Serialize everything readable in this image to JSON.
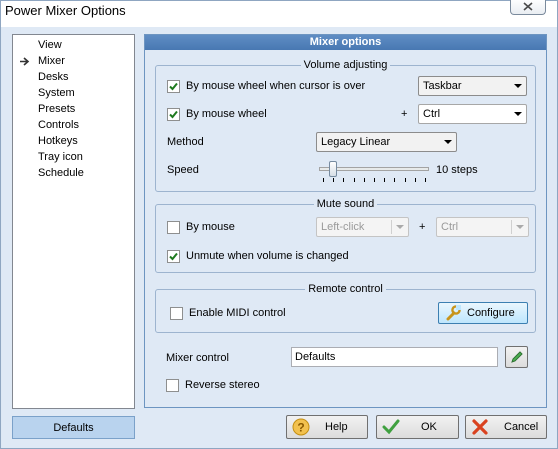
{
  "window": {
    "title": "Power Mixer Options"
  },
  "nav": {
    "items": [
      {
        "label": "View"
      },
      {
        "label": "Mixer",
        "selected": true
      },
      {
        "label": "Desks"
      },
      {
        "label": "System"
      },
      {
        "label": "Presets"
      },
      {
        "label": "Controls"
      },
      {
        "label": "Hotkeys"
      },
      {
        "label": "Tray icon"
      },
      {
        "label": "Schedule"
      }
    ]
  },
  "panel": {
    "header": "Mixer options",
    "volume": {
      "title": "Volume adjusting",
      "wheel_over": {
        "label": "By mouse wheel when cursor is over",
        "checked": true,
        "target": "Taskbar"
      },
      "wheel": {
        "label": "By mouse wheel",
        "checked": true,
        "plus": "+",
        "modifier": "Ctrl"
      },
      "method": {
        "label": "Method",
        "value": "Legacy Linear"
      },
      "speed": {
        "label": "Speed",
        "value_text": "10 steps",
        "steps": 10,
        "ticks": 11,
        "position": 1
      }
    },
    "mute": {
      "title": "Mute sound",
      "by_mouse": {
        "label": "By mouse",
        "checked": false,
        "button": "Left-click",
        "plus": "+",
        "modifier": "Ctrl"
      },
      "unmute": {
        "label": "Unmute when volume is changed",
        "checked": true
      }
    },
    "remote": {
      "title": "Remote control",
      "midi": {
        "label": "Enable MIDI control",
        "checked": false
      },
      "configure_label": "Configure"
    },
    "mixer_control": {
      "label": "Mixer control",
      "value": "Defaults"
    },
    "reverse_stereo": {
      "label": "Reverse stereo",
      "checked": false
    }
  },
  "buttons": {
    "defaults": "Defaults",
    "help": "Help",
    "ok": "OK",
    "cancel": "Cancel"
  },
  "colors": {
    "accent": "#4a7ab5",
    "check": "#1e7a1e",
    "ok_check": "#3fa03f",
    "cancel_x": "#d9421f",
    "help_icon": "#e0a91e"
  }
}
